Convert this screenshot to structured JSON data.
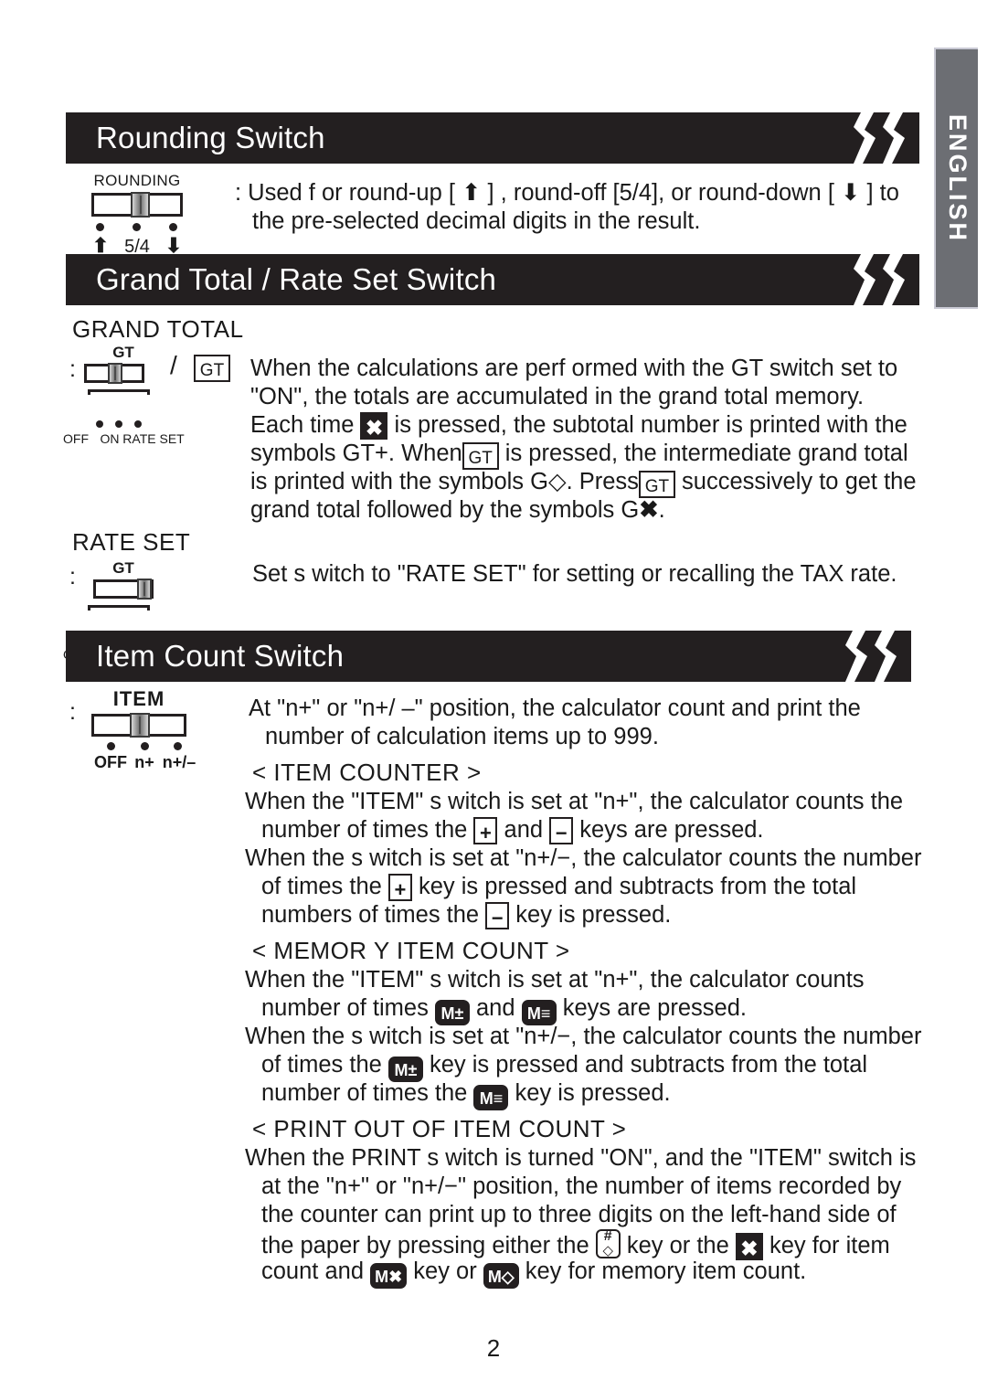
{
  "language_tab": {
    "label": "ENGLISH"
  },
  "sections": [
    {
      "id": "rounding",
      "title": "Rounding Switch",
      "switch": {
        "caption": "ROUNDING",
        "positions": [
          "⬆",
          "5/4",
          "⬇"
        ],
        "knob": "middle"
      },
      "lines": [
        ": Used f or round-up [ ⬆ ] , round-off [5/4], or round-down [ ⬇ ] to",
        "the pre-selected decimal digits in the result."
      ]
    },
    {
      "id": "grand-total-rate-set",
      "title": "Grand Total / Rate Set Switch",
      "subsections": [
        {
          "heading": "GRAND TOTAL",
          "switch": {
            "caption": "GT",
            "positions": [
              "OFF",
              "ON",
              "RATE SET"
            ],
            "knob": "middle"
          },
          "separator": "/",
          "key_badge": "GT",
          "lines": [
            "When the calculations are perf ormed with the GT switch set to",
            "\"ON\", the totals are accumulated in the grand total memory.",
            "Each time ✖ is pressed, the subtotal number is printed with the",
            "symbols GT+. When GT is pressed, the intermediate grand total",
            "is printed with the symbols G◇. Press GT successively to get the",
            "grand total followed by the symbols G✖."
          ]
        },
        {
          "heading": "RATE SET",
          "switch": {
            "caption": "GT",
            "positions": [
              "OFF",
              "ON",
              "RATE SET"
            ],
            "knob": "right"
          },
          "lines": [
            "Set s witch to \"RATE SET\" for setting or recalling the TAX rate."
          ]
        }
      ]
    },
    {
      "id": "item-count",
      "title": "Item Count Switch",
      "switch": {
        "caption": "ITEM",
        "positions": [
          "OFF",
          "n+",
          "n+/–"
        ],
        "knob": "middle"
      },
      "intro": [
        "At \"n+\" or \"n+/ –\" position, the calculator count and print the",
        "number of calculation items up to 999."
      ],
      "blocks": [
        {
          "heading": "< ITEM COUNTER >",
          "lines": [
            "When the \"ITEM\" s witch is set at \"n+\", the calculator counts the",
            "number of times the + and − keys are pressed.",
            "When the s witch is set at \"n+/−, the calculator counts the number",
            "of times the + key is pressed and subtracts from the total",
            "numbers of times the − key is pressed."
          ]
        },
        {
          "heading": "< MEMOR Y ITEM COUNT >",
          "lines": [
            "When the \"ITEM\" s witch is set at \"n+\", the calculator counts",
            "number of times M± and M≡ keys are pressed.",
            "When the s witch is set at \"n+/−, the calculator counts the number",
            "of times the M± key is pressed and subtracts from the total",
            "number of times the M≡ key is pressed."
          ]
        },
        {
          "heading": "< PRINT OUT OF ITEM COUNT >",
          "lines": [
            "When the PRINT s witch is turned \"ON\", and the \"ITEM\" switch is",
            "at the \"n+\" or \"n+/−\" position, the number of items recorded by",
            "the counter can print up to three digits on the left-hand side of",
            "the paper by pressing either the # key or the ✖ key for item",
            "count and M✖ key or M◇ key for memory item count."
          ]
        }
      ]
    }
  ],
  "keys": {
    "plus": "+",
    "minus": "−",
    "gt": "GT",
    "star": "✖",
    "m_plusminus": "M±",
    "m_equal": "M≡",
    "m_star": "M✖",
    "m_diamond": "M◇",
    "hash_top": "#",
    "hash_bottom": "◇"
  },
  "page_number": "2",
  "colors": {
    "header_bar": "#231f20",
    "lang_tab": "#6c6e73",
    "text": "#1a1a1a",
    "page_bg": "#ffffff"
  }
}
